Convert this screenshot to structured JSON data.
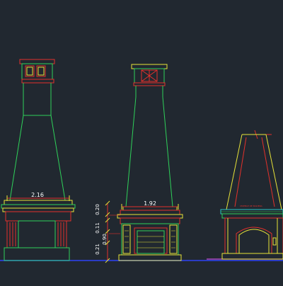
{
  "drawing": {
    "dimensions": {
      "left_width": "2.16",
      "center_width": "1.92",
      "vert_top": "0.20",
      "vert_mid": "0.11",
      "vert_body": "0.90",
      "vert_base": "0.21"
    },
    "right_annotation": "MUEBLE DE MADERA"
  },
  "colors": {
    "background": "#212830",
    "green": "#2fd15a",
    "red": "#e2312b",
    "yellow": "#e7e339",
    "magenta": "#c84fd8",
    "cyan": "#27c6c8",
    "blue": "#2a3cc4"
  }
}
